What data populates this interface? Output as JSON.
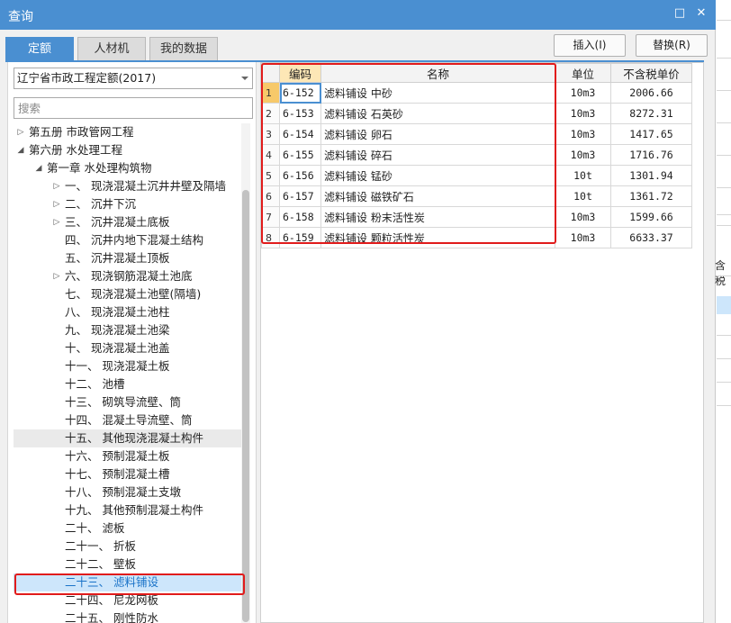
{
  "window": {
    "title": "查询",
    "maximize_icon": "maximize-icon",
    "close_icon": "close-icon"
  },
  "tabs": [
    {
      "label": "定额",
      "active": true
    },
    {
      "label": "人材机",
      "active": false
    },
    {
      "label": "我的数据",
      "active": false
    }
  ],
  "actions": {
    "insert_label": "插入(I)",
    "replace_label": "替换(R)"
  },
  "library": {
    "selected": "辽宁省市政工程定额(2017)"
  },
  "search": {
    "placeholder": "搜索"
  },
  "tree": [
    {
      "label": "第五册 市政管网工程",
      "level": 0,
      "expander": "collapsed"
    },
    {
      "label": "第六册 水处理工程",
      "level": 0,
      "expander": "expanded"
    },
    {
      "label": "第一章 水处理构筑物",
      "level": 1,
      "expander": "expanded"
    },
    {
      "label": "一、 现浇混凝土沉井井壁及隔墙",
      "level": 2,
      "expander": "collapsed"
    },
    {
      "label": "二、 沉井下沉",
      "level": 2,
      "expander": "collapsed"
    },
    {
      "label": "三、 沉井混凝土底板",
      "level": 2,
      "expander": "collapsed"
    },
    {
      "label": "四、 沉井内地下混凝土结构",
      "level": 2,
      "expander": "none"
    },
    {
      "label": "五、 沉井混凝土顶板",
      "level": 2,
      "expander": "none"
    },
    {
      "label": "六、 现浇钢筋混凝土池底",
      "level": 2,
      "expander": "collapsed"
    },
    {
      "label": "七、 现浇混凝土池壁(隔墙)",
      "level": 2,
      "expander": "none"
    },
    {
      "label": "八、 现浇混凝土池柱",
      "level": 2,
      "expander": "none"
    },
    {
      "label": "九、 现浇混凝土池梁",
      "level": 2,
      "expander": "none"
    },
    {
      "label": "十、 现浇混凝土池盖",
      "level": 2,
      "expander": "none"
    },
    {
      "label": "十一、 现浇混凝土板",
      "level": 2,
      "expander": "none"
    },
    {
      "label": "十二、 池槽",
      "level": 2,
      "expander": "none"
    },
    {
      "label": "十三、 砌筑导流壁、筒",
      "level": 2,
      "expander": "none"
    },
    {
      "label": "十四、 混凝土导流壁、筒",
      "level": 2,
      "expander": "none"
    },
    {
      "label": "十五、 其他现浇混凝土构件",
      "level": 2,
      "expander": "none",
      "state": "hover"
    },
    {
      "label": "十六、 预制混凝土板",
      "level": 2,
      "expander": "none"
    },
    {
      "label": "十七、 预制混凝土槽",
      "level": 2,
      "expander": "none"
    },
    {
      "label": "十八、 预制混凝土支墩",
      "level": 2,
      "expander": "none"
    },
    {
      "label": "十九、 其他预制混凝土构件",
      "level": 2,
      "expander": "none"
    },
    {
      "label": "二十、 滤板",
      "level": 2,
      "expander": "none"
    },
    {
      "label": "二十一、 折板",
      "level": 2,
      "expander": "none"
    },
    {
      "label": "二十二、 壁板",
      "level": 2,
      "expander": "none"
    },
    {
      "label": "二十三、 滤料铺设",
      "level": 2,
      "expander": "none",
      "state": "selected"
    },
    {
      "label": "二十四、 尼龙网板",
      "level": 2,
      "expander": "none"
    },
    {
      "label": "二十五、 刚性防水",
      "level": 2,
      "expander": "none"
    }
  ],
  "grid": {
    "headers": [
      "",
      "编码",
      "名称",
      "单位",
      "不含税单价"
    ],
    "rows": [
      {
        "idx": "1",
        "code": "6-152",
        "name": "滤料铺设 中砂",
        "unit": "10m3",
        "price": "2006.66"
      },
      {
        "idx": "2",
        "code": "6-153",
        "name": "滤料铺设 石英砂",
        "unit": "10m3",
        "price": "8272.31"
      },
      {
        "idx": "3",
        "code": "6-154",
        "name": "滤料铺设 卵石",
        "unit": "10m3",
        "price": "1417.65"
      },
      {
        "idx": "4",
        "code": "6-155",
        "name": "滤料铺设 碎石",
        "unit": "10m3",
        "price": "1716.76"
      },
      {
        "idx": "5",
        "code": "6-156",
        "name": "滤料铺设 锰砂",
        "unit": "10t",
        "price": "1301.94"
      },
      {
        "idx": "6",
        "code": "6-157",
        "name": "滤料铺设 磁铁矿石",
        "unit": "10t",
        "price": "1361.72"
      },
      {
        "idx": "7",
        "code": "6-158",
        "name": "滤料铺设 粉末活性炭",
        "unit": "10m3",
        "price": "1599.66"
      },
      {
        "idx": "8",
        "code": "6-159",
        "name": "滤料铺设 颗粒活性炭",
        "unit": "10m3",
        "price": "6633.37"
      }
    ]
  },
  "background_window": {
    "partial_text": "含税"
  },
  "colors": {
    "accent": "#4a8fd1",
    "highlight_red": "#e11b1b",
    "selected_bg": "#cde6fb"
  }
}
